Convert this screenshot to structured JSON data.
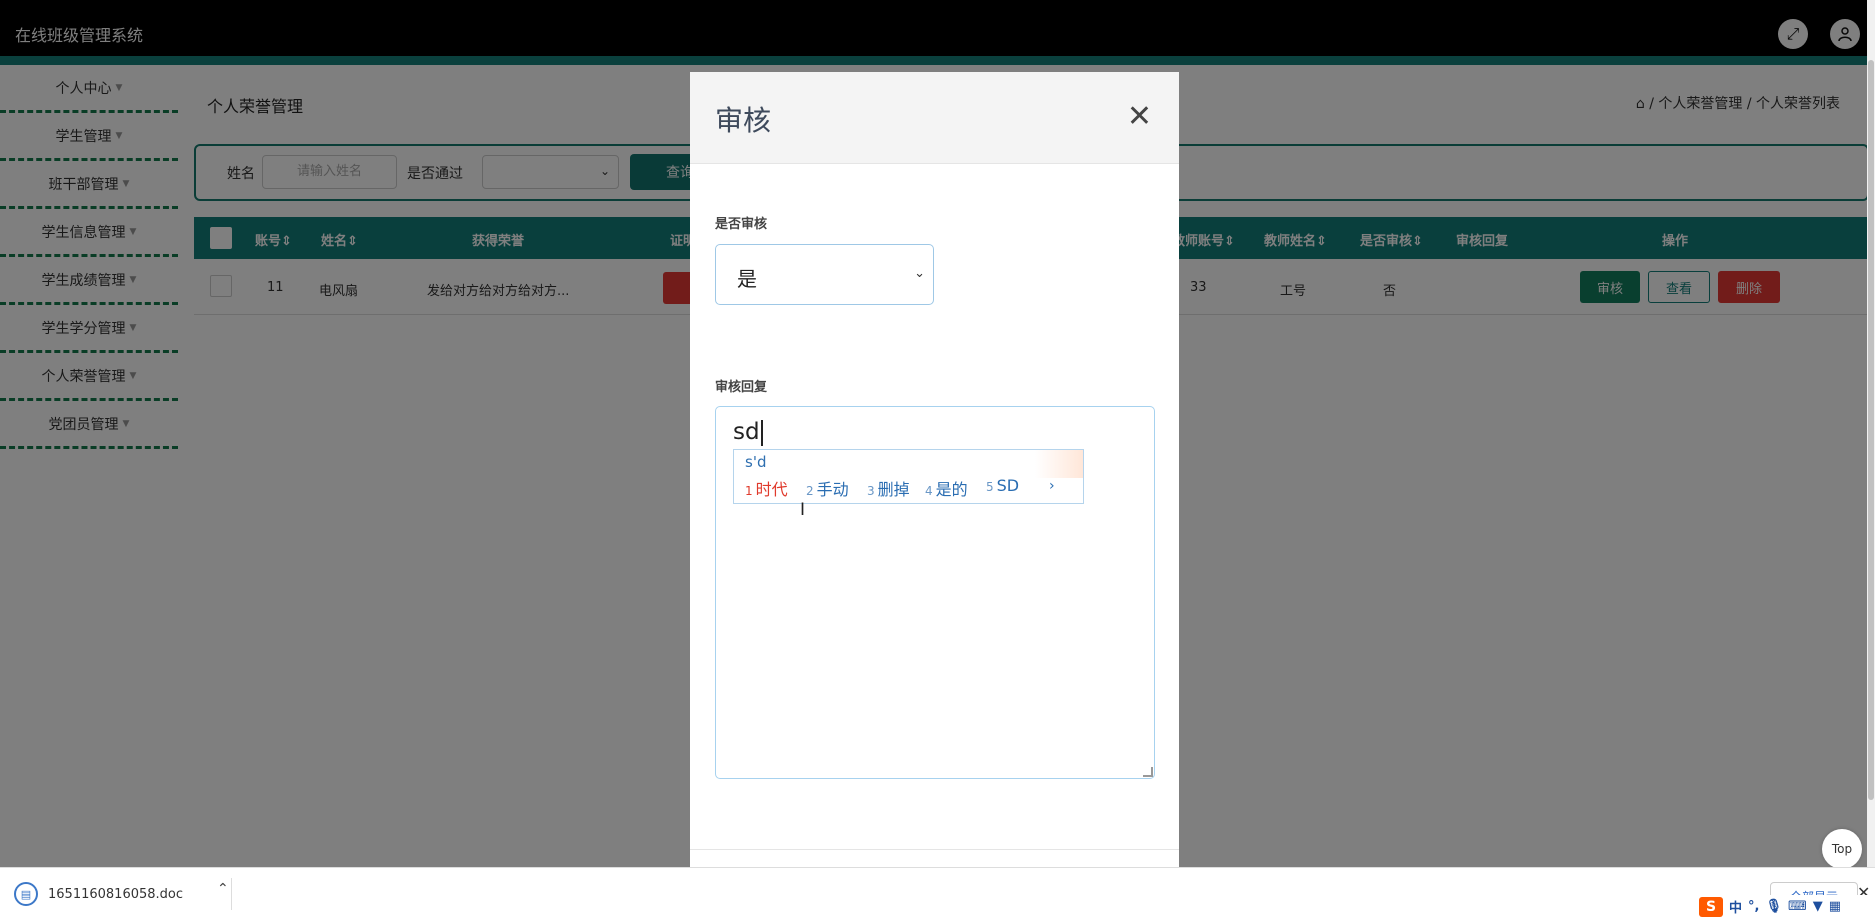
{
  "app": {
    "title": "在线班级管理系统"
  },
  "topbar": {
    "fullscreen_icon": "fullscreen-icon",
    "user_icon": "user-icon"
  },
  "sidebar": {
    "items": [
      {
        "label": "个人中心"
      },
      {
        "label": "学生管理"
      },
      {
        "label": "班干部管理"
      },
      {
        "label": "学生信息管理"
      },
      {
        "label": "学生成绩管理"
      },
      {
        "label": "学生学分管理"
      },
      {
        "label": "个人荣誉管理"
      },
      {
        "label": "党团员管理"
      }
    ]
  },
  "main": {
    "page_title": "个人荣誉管理",
    "breadcrumb": "/ 个人荣誉管理 / 个人荣誉列表",
    "search": {
      "name_label": "姓名",
      "name_placeholder": "请输入姓名",
      "pass_label": "是否通过",
      "query_label": "查询"
    },
    "table": {
      "headers": {
        "account": "账号",
        "name": "姓名",
        "honor": "获得荣誉",
        "cert": "证明",
        "teacher_account": "教师账号",
        "teacher_name": "教师姓名",
        "reviewed": "是否审核",
        "reply": "审核回复",
        "actions": "操作"
      },
      "row": {
        "account": "11",
        "name": "电风扇",
        "honor": "发给对方给对方给对方...",
        "teacher_account": "33",
        "teacher_name": "工号",
        "reviewed": "否",
        "btn_review": "审核",
        "btn_view": "查看",
        "btn_delete": "删除"
      }
    }
  },
  "modal": {
    "title": "审核",
    "review_label": "是否审核",
    "review_value": "是",
    "reply_label": "审核回复",
    "reply_value": "sd"
  },
  "ime": {
    "composition": "s'd",
    "candidates": [
      {
        "num": "1",
        "word": "时代"
      },
      {
        "num": "2",
        "word": "手动"
      },
      {
        "num": "3",
        "word": "删掉"
      },
      {
        "num": "4",
        "word": "是的"
      },
      {
        "num": "5",
        "word": "SD"
      }
    ],
    "more": "›"
  },
  "top_button": "Top",
  "downloads": {
    "file_name": "1651160816058.doc",
    "show_all": "全部显示"
  },
  "ime_bar": {
    "lang": "中"
  },
  "colors": {
    "accent": "#127e7a",
    "topbar": "#000000",
    "danger": "#e53935"
  }
}
